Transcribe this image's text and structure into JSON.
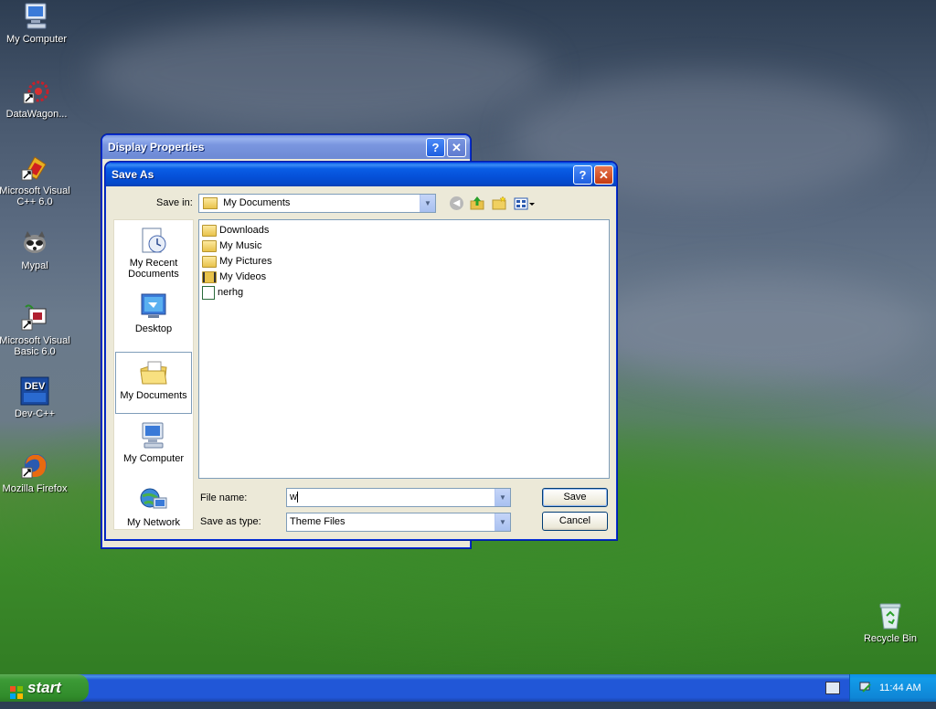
{
  "desktop": {
    "icons": [
      {
        "label": "My Computer"
      },
      {
        "label": "DataWagon..."
      },
      {
        "label": "Microsoft Visual C++ 6.0"
      },
      {
        "label": "Mypal"
      },
      {
        "label": "Microsoft Visual Basic 6.0"
      },
      {
        "label": "Dev-C++"
      },
      {
        "label": "Mozilla Firefox"
      },
      {
        "label": "Recycle Bin"
      }
    ]
  },
  "display_properties": {
    "title": "Display Properties",
    "help_btn": "?",
    "close_btn": "✕"
  },
  "save_as": {
    "title": "Save As",
    "help_btn": "?",
    "close_btn": "✕",
    "save_in_label": "Save in:",
    "save_in_value": "My Documents",
    "places": [
      {
        "label": "My Recent Documents"
      },
      {
        "label": "Desktop"
      },
      {
        "label": "My Documents"
      },
      {
        "label": "My Computer"
      },
      {
        "label": "My Network"
      }
    ],
    "files": [
      {
        "name": "Downloads",
        "icon": "folder-icon"
      },
      {
        "name": "My Music",
        "icon": "music-folder-icon"
      },
      {
        "name": "My Pictures",
        "icon": "pictures-folder-icon"
      },
      {
        "name": "My Videos",
        "icon": "videos-folder-icon"
      },
      {
        "name": "nerhg",
        "icon": "file-icon"
      }
    ],
    "file_name_label": "File name:",
    "file_name_value": "w",
    "save_type_label": "Save as type:",
    "save_type_value": "Theme Files",
    "save_button": "Save",
    "cancel_button": "Cancel"
  },
  "taskbar": {
    "start_label": "start",
    "clock": "11:44 AM"
  }
}
